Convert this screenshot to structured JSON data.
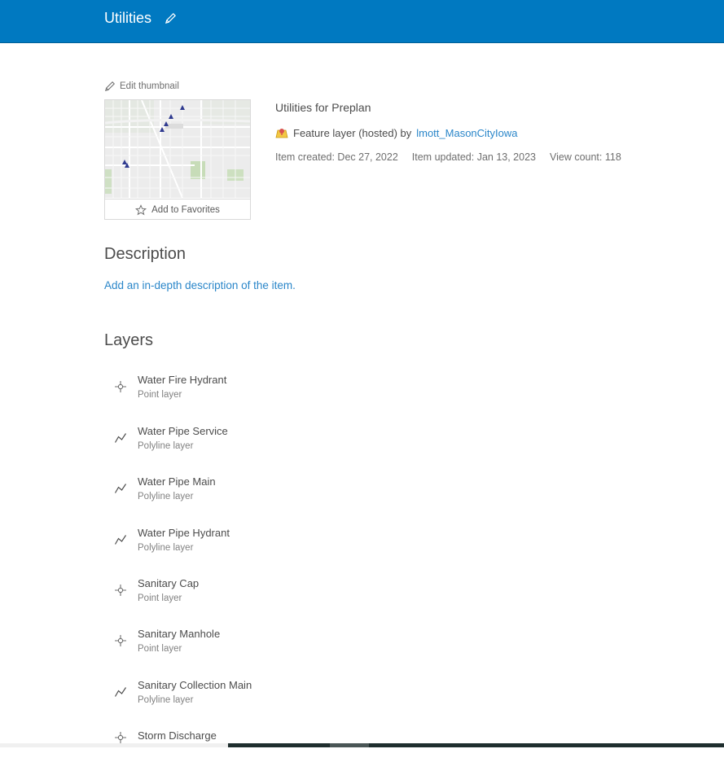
{
  "header": {
    "title": "Utilities"
  },
  "thumbnail": {
    "edit_label": "Edit thumbnail",
    "favorites_label": "Add to Favorites"
  },
  "item": {
    "title": "Utilities for Preplan",
    "type_text": "Feature layer (hosted) by",
    "owner": "lmott_MasonCityIowa",
    "created": "Item created: Dec 27, 2022",
    "updated": "Item updated: Jan 13, 2023",
    "views": "View count: 118"
  },
  "description": {
    "heading": "Description",
    "add_link": "Add an in-depth description of the item."
  },
  "layers": {
    "heading": "Layers",
    "items": [
      {
        "name": "Water Fire Hydrant",
        "type": "Point layer",
        "icon": "point-layer-icon"
      },
      {
        "name": "Water Pipe Service",
        "type": "Polyline layer",
        "icon": "polyline-layer-icon"
      },
      {
        "name": "Water Pipe Main",
        "type": "Polyline layer",
        "icon": "polyline-layer-icon"
      },
      {
        "name": "Water Pipe Hydrant",
        "type": "Polyline layer",
        "icon": "polyline-layer-icon"
      },
      {
        "name": "Sanitary Cap",
        "type": "Point layer",
        "icon": "point-layer-icon"
      },
      {
        "name": "Sanitary Manhole",
        "type": "Point layer",
        "icon": "point-layer-icon"
      },
      {
        "name": "Sanitary Collection Main",
        "type": "Polyline layer",
        "icon": "polyline-layer-icon"
      },
      {
        "name": "Storm Discharge",
        "type": "",
        "icon": "point-layer-icon"
      }
    ]
  },
  "colors": {
    "header": "#0079c1",
    "link": "#2a86c9"
  }
}
